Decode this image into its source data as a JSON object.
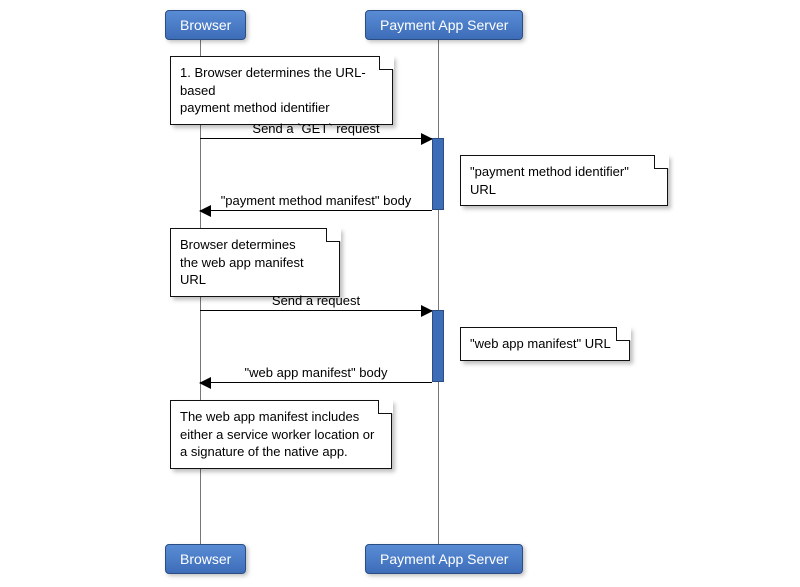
{
  "participants": {
    "left": "Browser",
    "right": "Payment App Server"
  },
  "notes": {
    "n1": "1. Browser determines the URL-based\npayment method identifier",
    "n2": "\"payment method identifier\" URL",
    "n3": "Browser determines\nthe web app manifest URL",
    "n4": "\"web app manifest\" URL",
    "n5": "The web app manifest includes\neither a service worker location or\na signature of the native app."
  },
  "messages": {
    "m1": "Send a `GET` request",
    "m2": "\"payment method manifest\" body",
    "m3": "Send a request",
    "m4": "\"web app manifest\" body"
  }
}
